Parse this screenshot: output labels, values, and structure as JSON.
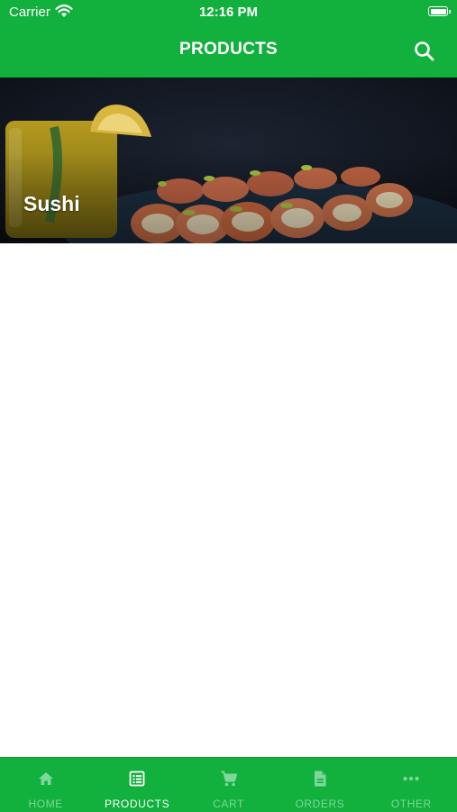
{
  "status_bar": {
    "carrier": "Carrier",
    "time": "12:16 PM"
  },
  "header": {
    "title": "PRODUCTS"
  },
  "categories": [
    {
      "label": "Sushi"
    }
  ],
  "tabs": [
    {
      "label": "HOME",
      "icon": "home-icon",
      "active": false
    },
    {
      "label": "PRODUCTS",
      "icon": "list-icon",
      "active": true
    },
    {
      "label": "CART",
      "icon": "cart-icon",
      "active": false
    },
    {
      "label": "ORDERS",
      "icon": "document-icon",
      "active": false
    },
    {
      "label": "OTHER",
      "icon": "more-icon",
      "active": false
    }
  ],
  "colors": {
    "brand_green": "#12b03d",
    "inactive_tab": "#7fd89a",
    "active_tab": "#ffffff"
  }
}
